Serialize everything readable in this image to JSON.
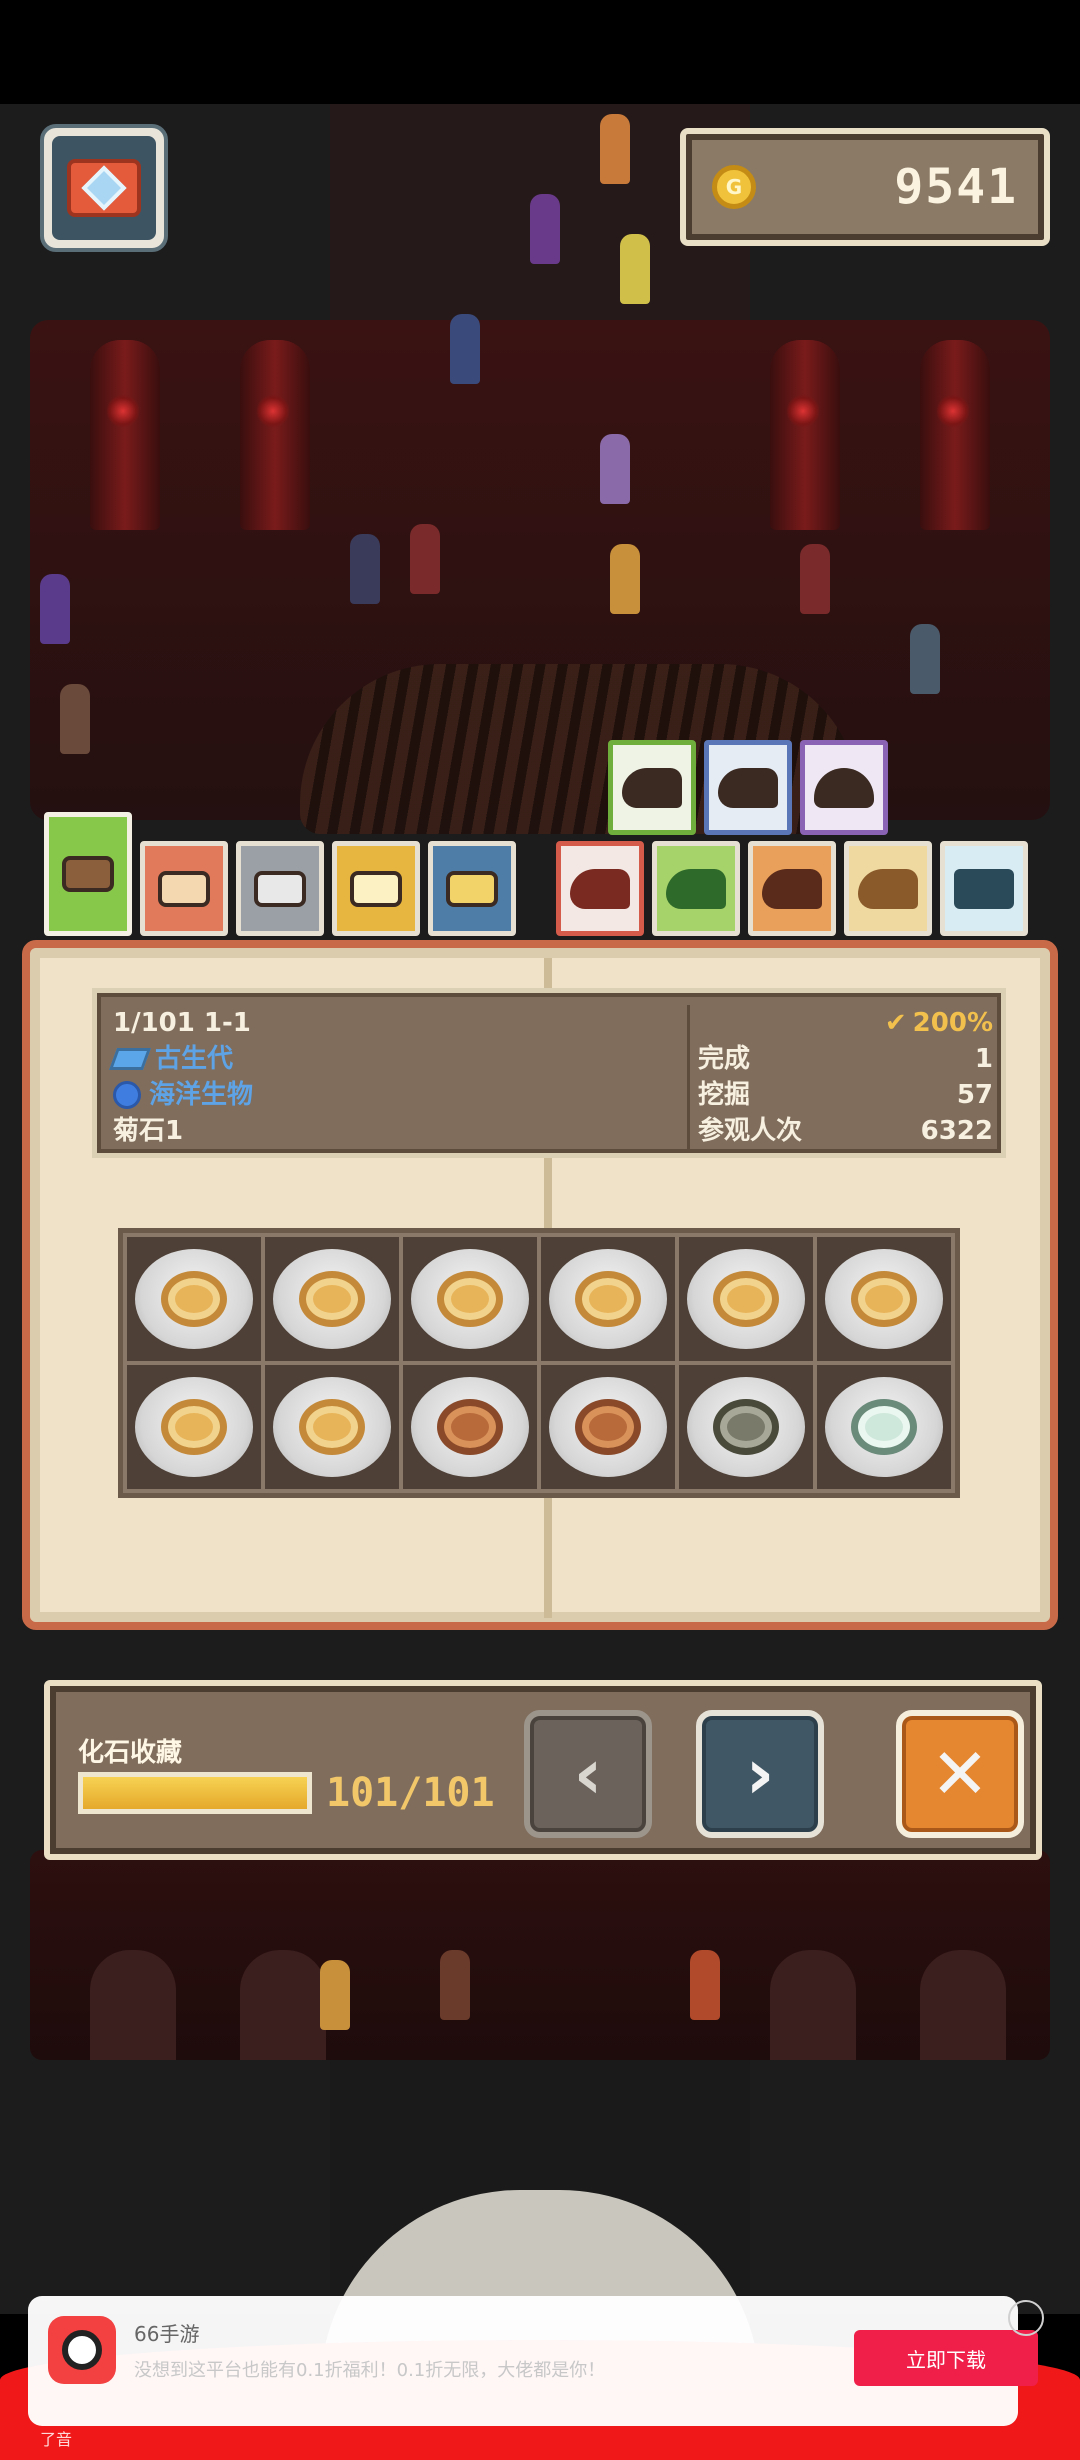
{
  "hud": {
    "coins": "9541",
    "coin_symbol": "G"
  },
  "tabs": {
    "upper": [
      "raptor-tab",
      "sauropod-tab",
      "mammoth-tab"
    ],
    "lower": [
      "crate-tab",
      "box-red-tab",
      "box-gray-tab",
      "box-gold-tab",
      "box-blue-tab",
      "trex-tab",
      "stego-green-tab",
      "stego-orange-tab",
      "pteranodon-tab",
      "palm-tab"
    ]
  },
  "info": {
    "index": "1/101 1-1",
    "percent": "200%",
    "era": "古生代",
    "group": "海洋生物",
    "name": "菊石1",
    "stats": [
      {
        "label": "完成",
        "value": "1"
      },
      {
        "label": "挖掘",
        "value": "57"
      },
      {
        "label": "参观人次",
        "value": "6322"
      }
    ]
  },
  "fossils": [
    "ammonite",
    "ammonite",
    "ammonite",
    "ammonite",
    "ammonite",
    "ammonite",
    "ammonite",
    "ammonite",
    "ammonite",
    "ammonite",
    "ammonite",
    "ammonite"
  ],
  "collection": {
    "title": "化石收藏",
    "progress_text": "101/101",
    "progress": 1.0
  },
  "buttons": {
    "prev": "‹",
    "next": "›",
    "close": "✕"
  },
  "ad": {
    "title": "66手游",
    "description": "没想到这平台也能有0.1折福利！0.1折无限，大佬都是你！",
    "button": "立即下载",
    "footer": "了音"
  },
  "colors": {
    "panel": "#806d5c",
    "gold": "#f1c76a",
    "accent_orange": "#e58630",
    "ad_red": "#ef1f4a"
  }
}
